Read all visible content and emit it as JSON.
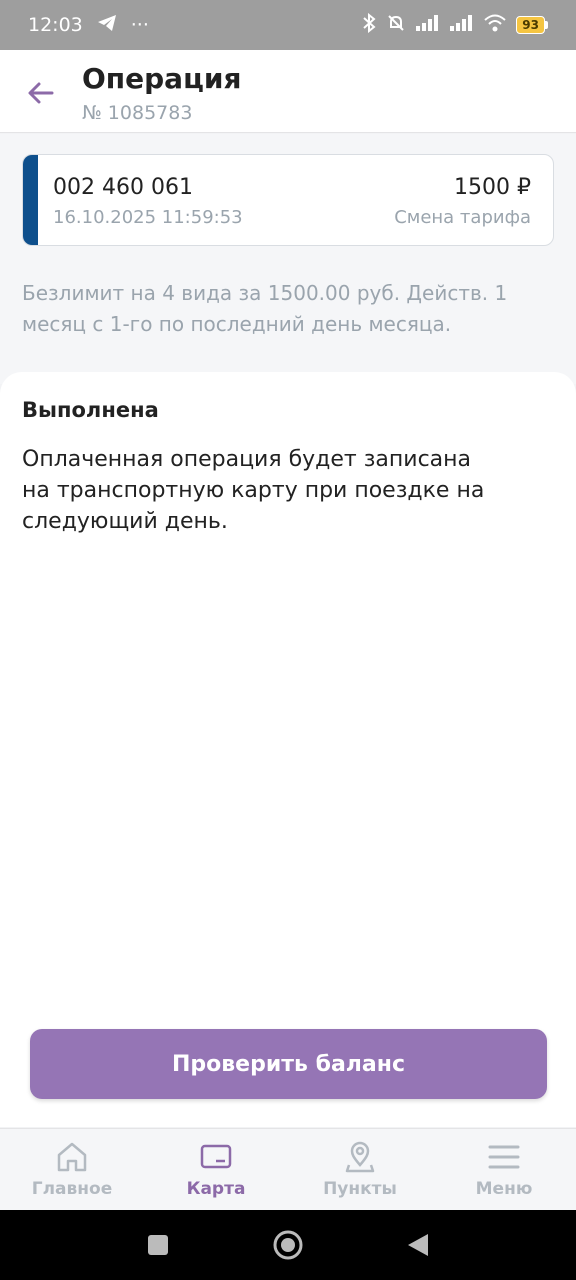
{
  "status_bar": {
    "time": "12:03",
    "dots": "···",
    "battery": "93"
  },
  "header": {
    "title": "Операция",
    "subtitle": "№ 1085783"
  },
  "operation": {
    "card_number": "002 460 061",
    "datetime": "16.10.2025 11:59:53",
    "amount": "1500 ₽",
    "type": "Смена тарифа",
    "stripe_color": "#0e4f8c",
    "description": "Безлимит на 4 вида за 1500.00 руб. Действ. 1 месяц с 1-го по последний день месяца."
  },
  "status": {
    "title": "Выполнена",
    "text": "Оплаченная операция будет записана на транспортную карту при поездке на следующий день."
  },
  "actions": {
    "check_balance_label": "Проверить баланс"
  },
  "bottom_nav": {
    "items": [
      {
        "label": "Главное",
        "icon": "home-icon",
        "active": false
      },
      {
        "label": "Карта",
        "icon": "card-icon",
        "active": true
      },
      {
        "label": "Пункты",
        "icon": "location-pin-icon",
        "active": false
      },
      {
        "label": "Меню",
        "icon": "menu-icon",
        "active": false
      }
    ]
  },
  "colors": {
    "accent": "#9575b5",
    "active_nav": "#8c6aa8",
    "muted_text": "#9aa4ad"
  }
}
